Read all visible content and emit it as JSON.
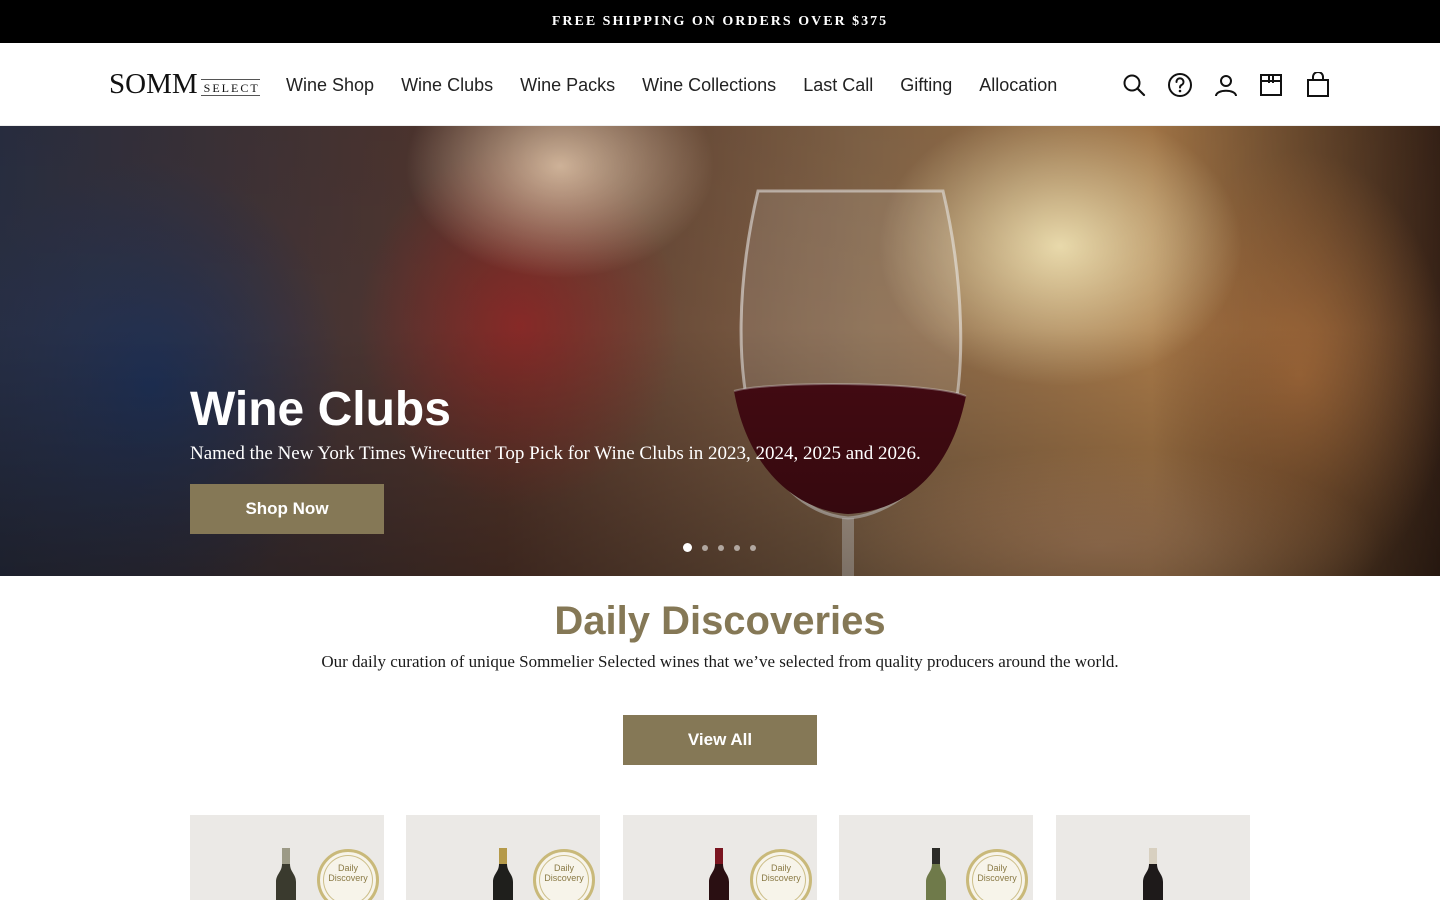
{
  "announcement": "FREE SHIPPING ON ORDERS OVER $375",
  "logo": {
    "primary": "SOMM",
    "secondary": "SELECT"
  },
  "nav": [
    "Wine Shop",
    "Wine Clubs",
    "Wine Packs",
    "Wine Collections",
    "Last Call",
    "Gifting",
    "Allocation"
  ],
  "header_icons": [
    "search-icon",
    "help-icon",
    "account-icon",
    "gift-box-icon",
    "cart-icon"
  ],
  "hero": {
    "title": "Wine Clubs",
    "subtitle": "Named the New York Times Wirecutter Top Pick for Wine Clubs in 2023, 2024, 2025 and 2026.",
    "button": "Shop Now",
    "slide_count": 5,
    "active_slide": 1
  },
  "daily": {
    "title": "Daily Discoveries",
    "subtitle": "Our daily curation of unique Sommelier Selected wines that we’ve selected from quality producers around the world.",
    "button": "View All",
    "cards": [
      {
        "badge_line1": "Daily",
        "badge_line2": "Discovery",
        "bottle_color": "#3a3a2e",
        "capsule_color": "#9c9a86"
      },
      {
        "badge_line1": "Daily",
        "badge_line2": "Discovery",
        "bottle_color": "#1f1f1c",
        "capsule_color": "#b59a4a"
      },
      {
        "badge_line1": "Daily",
        "badge_line2": "Discovery",
        "bottle_color": "#2a0f12",
        "capsule_color": "#7a1520"
      },
      {
        "badge_line1": "Daily",
        "badge_line2": "Discovery",
        "bottle_color": "#6f7a4a",
        "capsule_color": "#2c2c28"
      },
      {
        "badge_line1": "",
        "badge_line2": "",
        "bottle_color": "#1e1a1a",
        "capsule_color": "#d8d0c0"
      }
    ]
  },
  "colors": {
    "accent": "#857856",
    "announcement_bg": "#000000"
  }
}
